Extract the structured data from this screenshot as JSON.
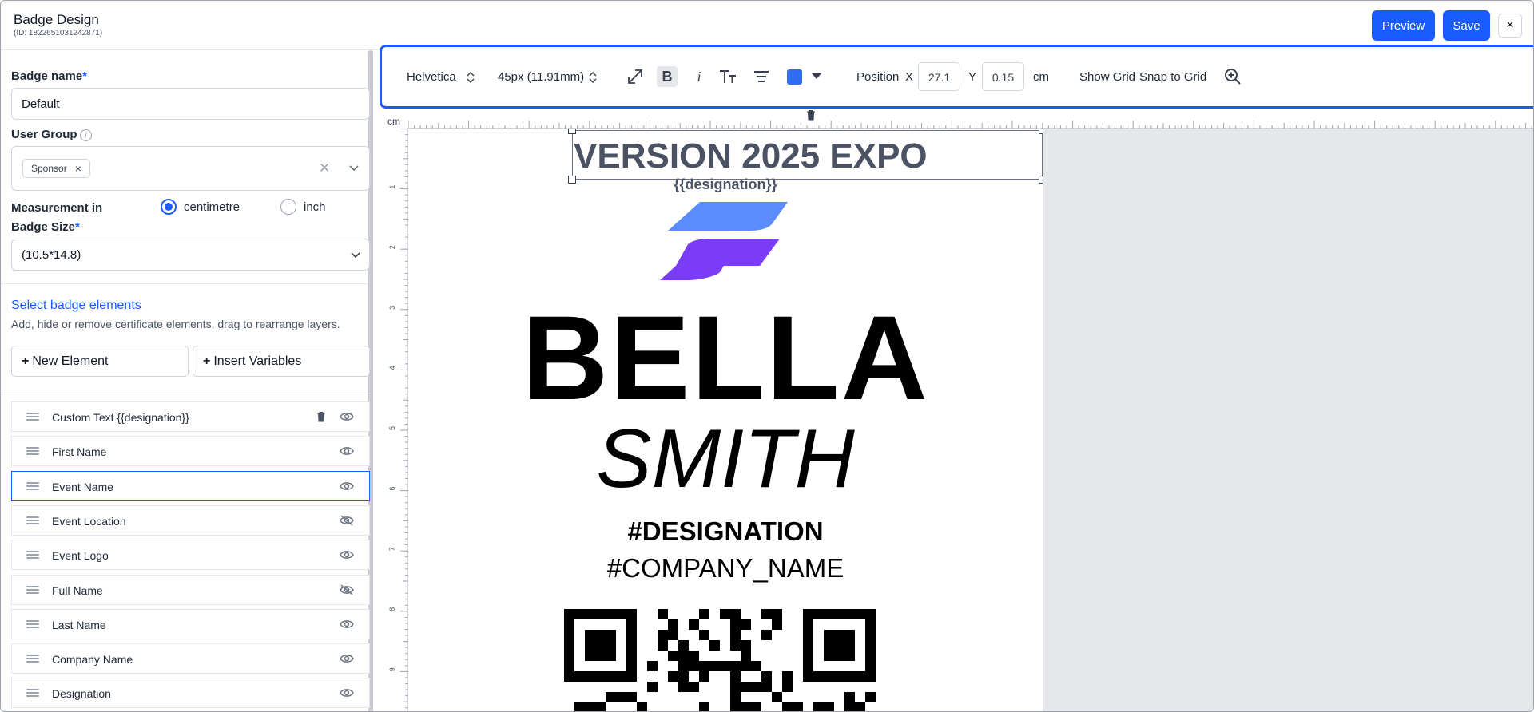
{
  "header": {
    "title": "Badge Design",
    "subtitle": "(ID: 1822651031242871)",
    "preview_label": "Preview",
    "save_label": "Save",
    "close_label": "×"
  },
  "form": {
    "badge_name_label": "Badge name",
    "required_mark": "*",
    "badge_name_value": "Default",
    "user_group_label": "User Group",
    "user_group_chips": [
      "Sponsor"
    ],
    "chip_remove": "×",
    "clear_label": "✕",
    "measurement_label": "Measurement in",
    "measurement_options": [
      "centimetre",
      "inch"
    ],
    "measurement_selected": "centimetre",
    "badge_size_label": "Badge Size",
    "badge_size_value": "(10.5*14.8)"
  },
  "elements_section": {
    "title": "Select badge elements",
    "description": "Add, hide or remove certificate elements, drag to rearrange layers.",
    "new_element_label": "New Element",
    "insert_variables_label": "Insert Variables",
    "plus": "+",
    "items": [
      {
        "label": "Custom Text {{designation}}",
        "visible": true,
        "deletable": true
      },
      {
        "label": "First Name",
        "visible": true
      },
      {
        "label": "Event Name",
        "visible": true,
        "selected": true
      },
      {
        "label": "Event Location",
        "visible": false
      },
      {
        "label": "Event Logo",
        "visible": true
      },
      {
        "label": "Full Name",
        "visible": false
      },
      {
        "label": "Last Name",
        "visible": true
      },
      {
        "label": "Company Name",
        "visible": true
      },
      {
        "label": "Designation",
        "visible": true
      }
    ]
  },
  "toolbar": {
    "font_family": "Helvetica",
    "font_size": "45px (11.91mm)",
    "bold_label": "B",
    "italic_label": "i",
    "text_color": "#2f6df6",
    "position_label": "Position",
    "x_label": "X",
    "x_value": "27.1",
    "y_label": "Y",
    "y_value": "0.15",
    "unit": "cm",
    "show_grid_label": "Show Grid",
    "snap_grid_label": "Snap to Grid"
  },
  "canvas": {
    "ruler_unit": "cm",
    "ruler_left_ticks": [
      "1",
      "2",
      "3",
      "4",
      "5",
      "6",
      "7",
      "8",
      "9"
    ],
    "badge": {
      "event_name": "VERSION 2025 EXPO",
      "designation_variable": "{{designation}}",
      "first_name": "BELLA",
      "last_name": "SMITH",
      "designation": "#DESIGNATION",
      "company_name": "#COMPANY_NAME"
    }
  },
  "colors": {
    "accent": "#1a5cff",
    "logo_top": "#5b8cff",
    "logo_bottom": "#7a3cf5"
  }
}
